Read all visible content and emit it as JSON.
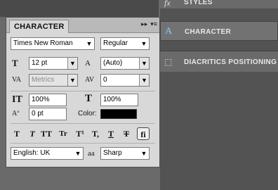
{
  "dock": {
    "items": [
      {
        "icon": "fx-icon",
        "glyph": "fx",
        "label": "STYLES"
      },
      {
        "icon": "character-icon",
        "glyph": "A",
        "label": "CHARACTER"
      },
      {
        "icon": "diacritics-icon",
        "glyph": "⬚",
        "label": "DIACRITICS POSITIONING"
      }
    ]
  },
  "panel": {
    "title": "CHARACTER",
    "collapse_glyph": "▸▸",
    "menu_glyph": "▾≡",
    "font_family": "Times New Roman",
    "font_style": "Regular",
    "font_size": "12 pt",
    "leading": "(Auto)",
    "kerning": "Metrics",
    "tracking": "0",
    "vertical_scale": "100%",
    "horizontal_scale": "100%",
    "baseline_shift": "0 pt",
    "color_label": "Color:",
    "language": "English: UK",
    "antialias": "Sharp",
    "antialias_icon_text": "aa",
    "style_buttons": [
      "T",
      "T",
      "TT",
      "Tr",
      "T¹",
      "T,",
      "T",
      "T",
      "fi"
    ]
  },
  "colors": {
    "text_color": "#000000"
  }
}
